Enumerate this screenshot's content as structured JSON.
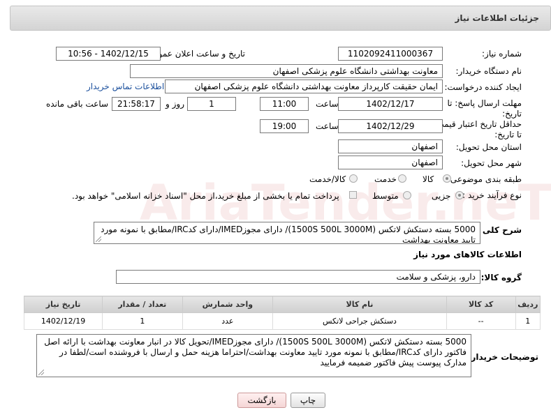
{
  "header": {
    "title": "جزئیات اطلاعات نیاز"
  },
  "fields": {
    "need_number_label": "شماره نیاز:",
    "need_number": "1102092411000367",
    "announce_label": "تاریخ و ساعت اعلان عمومی:",
    "announce_value": "1402/12/15 - 10:56",
    "buyer_org_label": "نام دستگاه خریدار:",
    "buyer_org": "معاونت بهداشتی دانشگاه علوم پزشکی اصفهان",
    "creator_label": "ایجاد کننده درخواست:",
    "creator": "ایمان حقیقت کارپرداز معاونت بهداشتی دانشگاه علوم پزشکی اصفهان",
    "buyer_contact_link": "اطلاعات تماس خریدار",
    "reply_deadline_label": "مهلت ارسال پاسخ: تا تاریخ:",
    "reply_date": "1402/12/17",
    "time_label": "ساعت",
    "reply_time": "11:00",
    "days_value": "1",
    "days_label": "روز و",
    "remaining_time": "21:58:17",
    "remaining_label": "ساعت باقی مانده",
    "price_validity_label": "حداقل تاریخ اعتبار قیمت: تا تاریخ:",
    "price_date": "1402/12/29",
    "price_time": "19:00",
    "province_label": "استان محل تحویل:",
    "province": "اصفهان",
    "city_label": "شهر محل تحویل:",
    "city": "اصفهان",
    "category_label": "طبقه بندی موضوعی:",
    "category_options": [
      "کالا",
      "خدمت",
      "کالا/خدمت"
    ],
    "category_selected": "کالا",
    "process_label": "نوع فرآیند خرید :",
    "process_options": [
      "جزیی",
      "متوسط"
    ],
    "process_selected": "جزیی",
    "treasury_note": "پرداخت تمام یا بخشی از مبلغ خرید،از محل \"اسناد خزانه اسلامی\" خواهد بود."
  },
  "summary": {
    "label": "شرح کلی نیاز:",
    "text": "5000 بسته دستکش لاتکس (1500S  500L  3000M)/ دارای مجوزIMED/دارای کدIRC/مطابق با نمونه مورد تایید معاونت بهداشت"
  },
  "goods_section": {
    "title": "اطلاعات کالاهای مورد نیاز",
    "group_label": "گروه کالا:",
    "group_value": "دارو، پزشکی و سلامت"
  },
  "table": {
    "headers": [
      "ردیف",
      "کد کالا",
      "نام کالا",
      "واحد شمارش",
      "تعداد / مقدار",
      "تاریخ نیاز"
    ],
    "rows": [
      [
        "1",
        "--",
        "دستکش جراحی لاتکس",
        "عدد",
        "1",
        "1402/12/19"
      ]
    ]
  },
  "buyer_notes": {
    "label": "توضیحات خریدار:",
    "text": "5000 بسته دستکش لاتکس (1500S  500L  3000M)/ دارای مجوزIMED/تحویل کالا در انبار معاونت بهداشت با ارائه اصل فاکتور دارای کدIRC/مطابق با نمونه مورد تایید معاونت بهداشت/احتراما هزینه حمل و ارسال با فروشنده است/لطفا در مدارک پیوست پیش فاکتور ضمیمه فرمایید"
  },
  "buttons": {
    "print": "چاپ",
    "back": "بازگشت"
  },
  "watermark": "AriaTender.neT"
}
